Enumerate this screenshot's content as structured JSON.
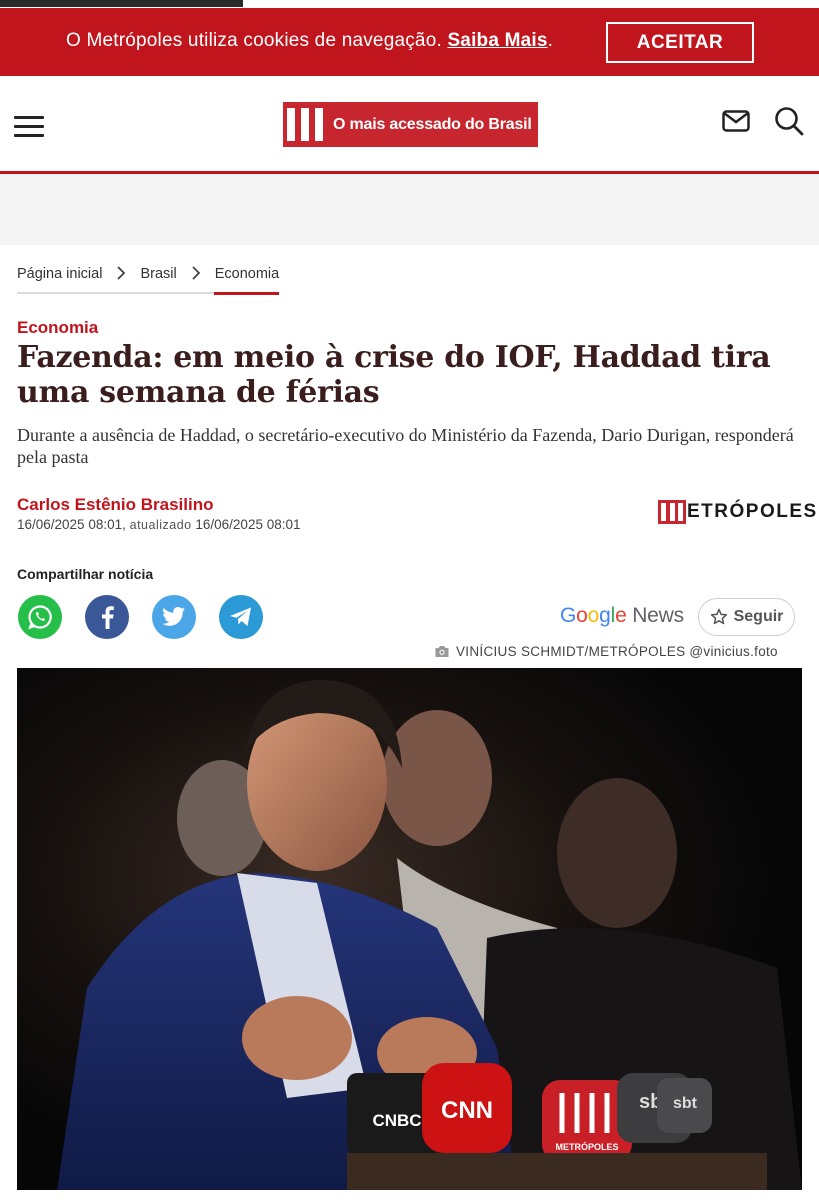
{
  "cookie_banner": {
    "text": "O Metrópoles utiliza cookies de navegação.",
    "link": "Saiba Mais",
    "trailing": ".",
    "accept": "ACEITAR"
  },
  "header": {
    "logo_text": "O mais acessado do Brasil"
  },
  "breadcrumb": [
    "Página inicial",
    "Brasil",
    "Economia"
  ],
  "article": {
    "category": "Economia",
    "headline": "Fazenda: em meio à crise do IOF, Haddad tira uma semana de férias",
    "subtitle": "Durante a ausência de Haddad, o secretário-executivo do Ministério da Fazenda, Dario Durigan, responderá pela pasta",
    "author": "Carlos Estênio Brasilino",
    "published": "16/06/2025 08:01,",
    "updated_label": "atualizado",
    "updated": "16/06/2025 08:01",
    "brand": "ETRÓPOLES"
  },
  "share": {
    "label": "Compartilhar notícia",
    "icons": [
      "whatsapp-icon",
      "facebook-icon",
      "twitter-icon",
      "telegram-icon"
    ]
  },
  "google_news": {
    "google_letters": [
      "G",
      "o",
      "o",
      "g",
      "l",
      "e"
    ],
    "news": "News",
    "follow": "Seguir"
  },
  "photo": {
    "credit": "VINÍCIUS SCHMIDT/METRÓPOLES @vinicius.foto",
    "mic_labels": [
      "CNBC",
      "CNN",
      "METRÓPOLES",
      "sbt",
      "sbt"
    ]
  },
  "colors": {
    "brand_red": "#c1151d",
    "headline": "#3a1e1e",
    "whatsapp": "#26bf4a",
    "facebook": "#3a5898",
    "twitter": "#4aa6e6",
    "telegram": "#2b9ad6"
  }
}
